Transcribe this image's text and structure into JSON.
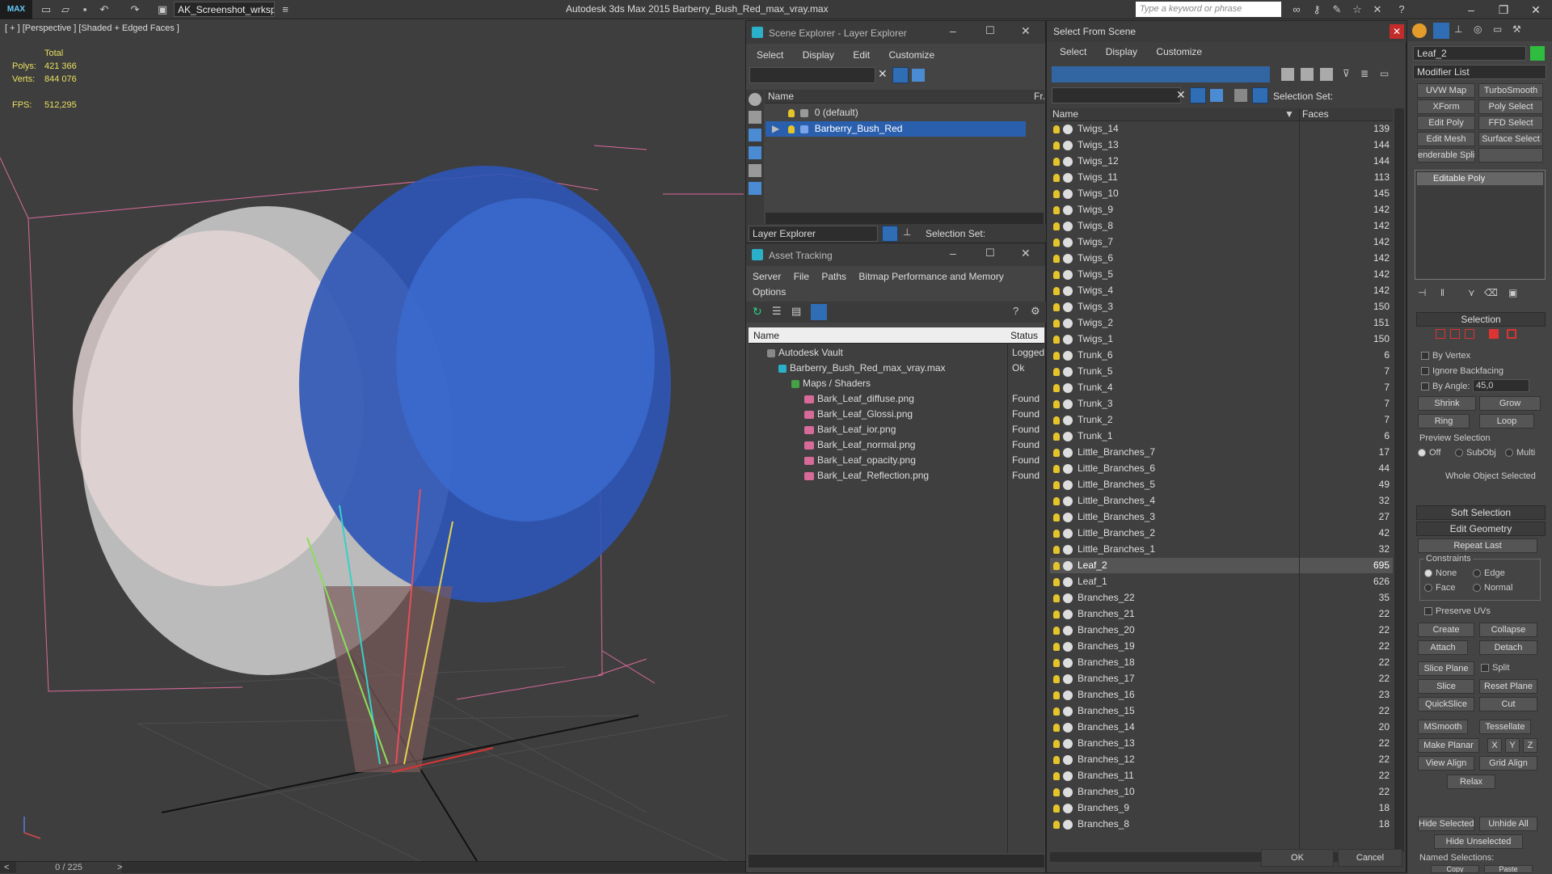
{
  "app": {
    "logo": "MAX",
    "workspace": "AK_Screenshot_wrksp",
    "title": "Autodesk 3ds Max  2015    Barberry_Bush_Red_max_vray.max",
    "search_placeholder": "Type a keyword or phrase"
  },
  "viewport": {
    "label": "[ + ] [Perspective ] [Shaded + Edged Faces ]",
    "stats": {
      "total_label": "Total",
      "polys_label": "Polys:",
      "polys": "421 366",
      "verts_label": "Verts:",
      "verts": "844 076",
      "fps_label": "FPS:",
      "fps": "512,295"
    },
    "frame": "0 / 225"
  },
  "scene_explorer": {
    "title": "Scene Explorer - Layer Explorer",
    "menu": [
      "Select",
      "Display",
      "Edit",
      "Customize"
    ],
    "col_name": "Name",
    "col_fr": "Fr.",
    "rows": [
      {
        "label": "0 (default)"
      },
      {
        "label": "Barberry_Bush_Red"
      }
    ],
    "footer_dropdown": "Layer Explorer",
    "selection_set": "Selection Set:"
  },
  "asset_tracking": {
    "title": "Asset Tracking",
    "menu": [
      "Server",
      "File",
      "Paths",
      "Bitmap Performance and Memory"
    ],
    "menu2": "Options",
    "col_name": "Name",
    "col_status": "Status",
    "rows": [
      {
        "name": "Autodesk Vault",
        "status": "Logged"
      },
      {
        "name": "Barberry_Bush_Red_max_vray.max",
        "status": "Ok"
      },
      {
        "name": "Maps / Shaders",
        "status": ""
      },
      {
        "name": "Bark_Leaf_diffuse.png",
        "status": "Found"
      },
      {
        "name": "Bark_Leaf_Glossi.png",
        "status": "Found"
      },
      {
        "name": "Bark_Leaf_ior.png",
        "status": "Found"
      },
      {
        "name": "Bark_Leaf_normal.png",
        "status": "Found"
      },
      {
        "name": "Bark_Leaf_opacity.png",
        "status": "Found"
      },
      {
        "name": "Bark_Leaf_Reflection.png",
        "status": "Found"
      }
    ]
  },
  "select_from_scene": {
    "title": "Select From Scene",
    "menu": [
      "Select",
      "Display",
      "Customize"
    ],
    "selection_set": "Selection Set:",
    "col_name": "Name",
    "col_faces": "Faces",
    "rows": [
      {
        "name": "Twigs_14",
        "faces": "139"
      },
      {
        "name": "Twigs_13",
        "faces": "144"
      },
      {
        "name": "Twigs_12",
        "faces": "144"
      },
      {
        "name": "Twigs_11",
        "faces": "113"
      },
      {
        "name": "Twigs_10",
        "faces": "145"
      },
      {
        "name": "Twigs_9",
        "faces": "142"
      },
      {
        "name": "Twigs_8",
        "faces": "142"
      },
      {
        "name": "Twigs_7",
        "faces": "142"
      },
      {
        "name": "Twigs_6",
        "faces": "142"
      },
      {
        "name": "Twigs_5",
        "faces": "142"
      },
      {
        "name": "Twigs_4",
        "faces": "142"
      },
      {
        "name": "Twigs_3",
        "faces": "150"
      },
      {
        "name": "Twigs_2",
        "faces": "151"
      },
      {
        "name": "Twigs_1",
        "faces": "150"
      },
      {
        "name": "Trunk_6",
        "faces": "6"
      },
      {
        "name": "Trunk_5",
        "faces": "7"
      },
      {
        "name": "Trunk_4",
        "faces": "7"
      },
      {
        "name": "Trunk_3",
        "faces": "7"
      },
      {
        "name": "Trunk_2",
        "faces": "7"
      },
      {
        "name": "Trunk_1",
        "faces": "6"
      },
      {
        "name": "Little_Branches_7",
        "faces": "17"
      },
      {
        "name": "Little_Branches_6",
        "faces": "44"
      },
      {
        "name": "Little_Branches_5",
        "faces": "49"
      },
      {
        "name": "Little_Branches_4",
        "faces": "32"
      },
      {
        "name": "Little_Branches_3",
        "faces": "27"
      },
      {
        "name": "Little_Branches_2",
        "faces": "42"
      },
      {
        "name": "Little_Branches_1",
        "faces": "32"
      },
      {
        "name": "Leaf_2",
        "faces": "695"
      },
      {
        "name": "Leaf_1",
        "faces": "626"
      },
      {
        "name": "Branches_22",
        "faces": "35"
      },
      {
        "name": "Branches_21",
        "faces": "22"
      },
      {
        "name": "Branches_20",
        "faces": "22"
      },
      {
        "name": "Branches_19",
        "faces": "22"
      },
      {
        "name": "Branches_18",
        "faces": "22"
      },
      {
        "name": "Branches_17",
        "faces": "22"
      },
      {
        "name": "Branches_16",
        "faces": "23"
      },
      {
        "name": "Branches_15",
        "faces": "22"
      },
      {
        "name": "Branches_14",
        "faces": "20"
      },
      {
        "name": "Branches_13",
        "faces": "22"
      },
      {
        "name": "Branches_12",
        "faces": "22"
      },
      {
        "name": "Branches_11",
        "faces": "22"
      },
      {
        "name": "Branches_10",
        "faces": "22"
      },
      {
        "name": "Branches_9",
        "faces": "18"
      },
      {
        "name": "Branches_8",
        "faces": "18"
      }
    ],
    "ok": "OK",
    "cancel": "Cancel"
  },
  "command_panel": {
    "object_name": "Leaf_2",
    "modifier_list": "Modifier List",
    "modifier_buttons": [
      [
        "UVW Map",
        "TurboSmooth"
      ],
      [
        "XForm",
        "Poly Select"
      ],
      [
        "Edit Poly",
        "FFD Select"
      ],
      [
        "Edit Mesh",
        "Surface Select"
      ],
      [
        "enderable Splin",
        ""
      ]
    ],
    "stack_item": "Editable Poly",
    "selection_title": "Selection",
    "by_vertex": "By Vertex",
    "ignore_backfacing": "Ignore Backfacing",
    "by_angle": "By Angle:",
    "angle_value": "45,0",
    "shrink": "Shrink",
    "grow": "Grow",
    "ring": "Ring",
    "loop": "Loop",
    "preview_selection": "Preview Selection",
    "preview_opts": [
      "Off",
      "SubObj",
      "Multi"
    ],
    "whole_object": "Whole Object Selected",
    "soft_selection": "Soft Selection",
    "edit_geometry": "Edit Geometry",
    "repeat_last": "Repeat Last",
    "constraints": "Constraints",
    "constraint_opts": [
      "None",
      "Edge",
      "Face",
      "Normal"
    ],
    "preserve_uvs": "Preserve UVs",
    "create": "Create",
    "collapse": "Collapse",
    "attach": "Attach",
    "detach": "Detach",
    "slice_plane": "Slice Plane",
    "split": "Split",
    "slice": "Slice",
    "reset_plane": "Reset Plane",
    "quickslice": "QuickSlice",
    "cut": "Cut",
    "msmooth": "MSmooth",
    "tessellate": "Tessellate",
    "make_planar": "Make Planar",
    "x": "X",
    "y": "Y",
    "z": "Z",
    "view_align": "View Align",
    "grid_align": "Grid Align",
    "relax": "Relax",
    "hide_selected": "Hide Selected",
    "unhide_all": "Unhide All",
    "hide_unselected": "Hide Unselected",
    "named_selections": "Named Selections:",
    "copy": "Copy",
    "paste": "Paste"
  },
  "colors": {
    "accent": "#2a5fae",
    "tool_blue": "#2f6db5",
    "stat_yellow": "#e8e060"
  }
}
